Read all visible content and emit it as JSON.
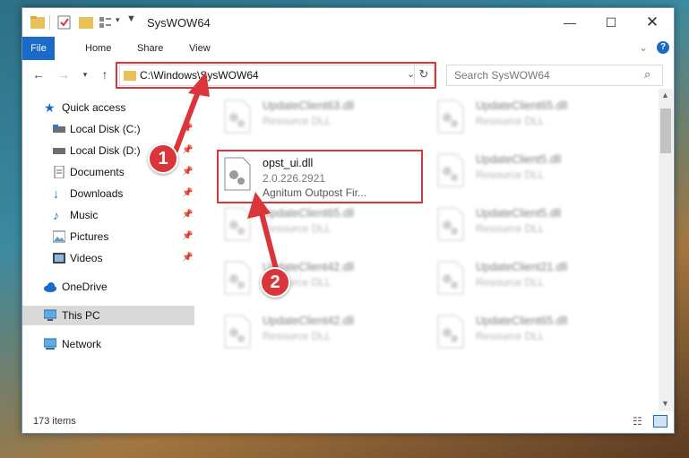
{
  "window": {
    "title": "SysWOW64"
  },
  "ribbon": {
    "tabs": [
      "File",
      "Home",
      "Share",
      "View"
    ]
  },
  "address": {
    "path": "C:\\Windows\\SysWOW64"
  },
  "search": {
    "placeholder": "Search SysWOW64"
  },
  "sidebar": {
    "quick_access": "Quick access",
    "items": [
      "Local Disk (C:)",
      "Local Disk (D:)",
      "Documents",
      "Downloads",
      "Music",
      "Pictures",
      "Videos"
    ],
    "onedrive": "OneDrive",
    "thispc": "This PC",
    "network": "Network"
  },
  "files": {
    "selected": {
      "name": "opst_ui.dll",
      "version": "2.0.226.2921",
      "desc": "Agnitum Outpost Fir..."
    },
    "others": [
      {
        "name": "UpdateClient63.dll",
        "desc": "Resource DLL"
      },
      {
        "name": "UpdateClient65.dll",
        "desc": "Resource DLL"
      },
      {
        "name": "UpdateClient5.dll",
        "desc": "Resource DLL"
      },
      {
        "name": "UpdateClient65.dll",
        "desc": "Resource DLL"
      },
      {
        "name": "UpdateClient5.dll",
        "desc": "Resource DLL"
      },
      {
        "name": "UpdateClient42.dll",
        "desc": "Resource DLL"
      },
      {
        "name": "UpdateClient21.dll",
        "desc": "Resource DLL"
      },
      {
        "name": "UpdateClient42.dll",
        "desc": "Resource DLL"
      },
      {
        "name": "UpdateClient65.dll",
        "desc": "Resource DLL"
      }
    ]
  },
  "status": {
    "count": "173 items"
  },
  "annotations": {
    "step1": "1",
    "step2": "2"
  },
  "colors": {
    "accent": "#1b6ac9",
    "highlight": "#d9353b"
  }
}
